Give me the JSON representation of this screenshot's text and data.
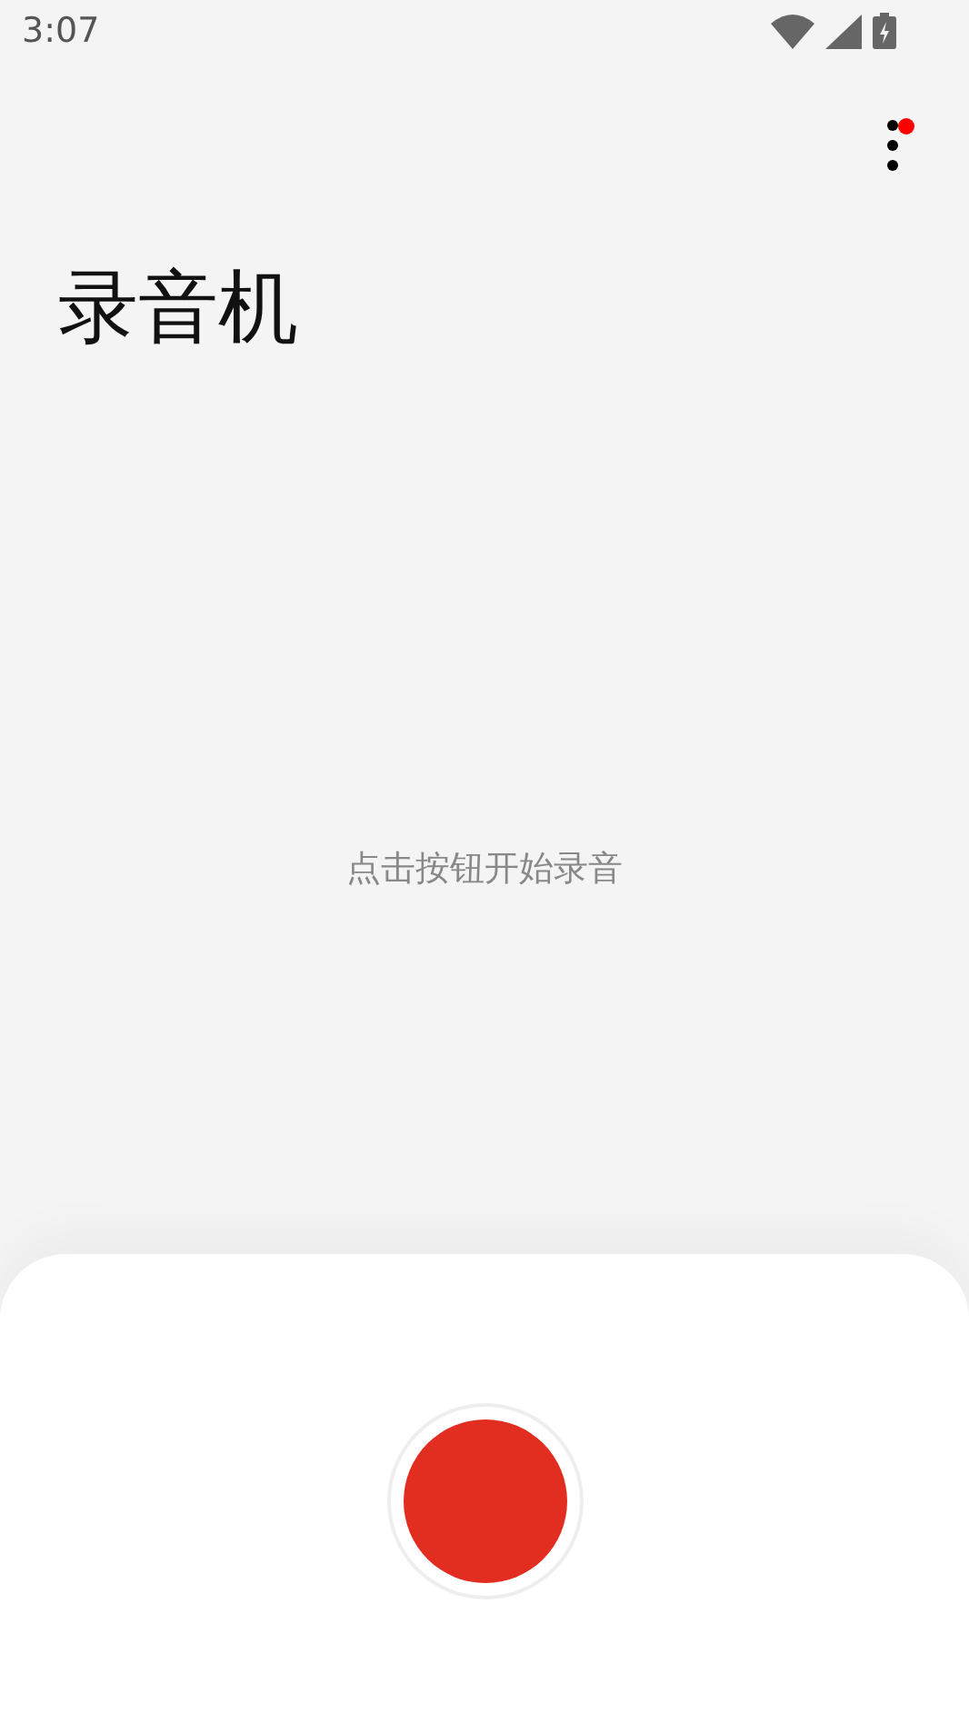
{
  "status_bar": {
    "time": "3:07"
  },
  "menu": {
    "has_notification": true
  },
  "title": "录音机",
  "hint": "点击按钮开始录音",
  "record_button": {
    "recording": false
  }
}
